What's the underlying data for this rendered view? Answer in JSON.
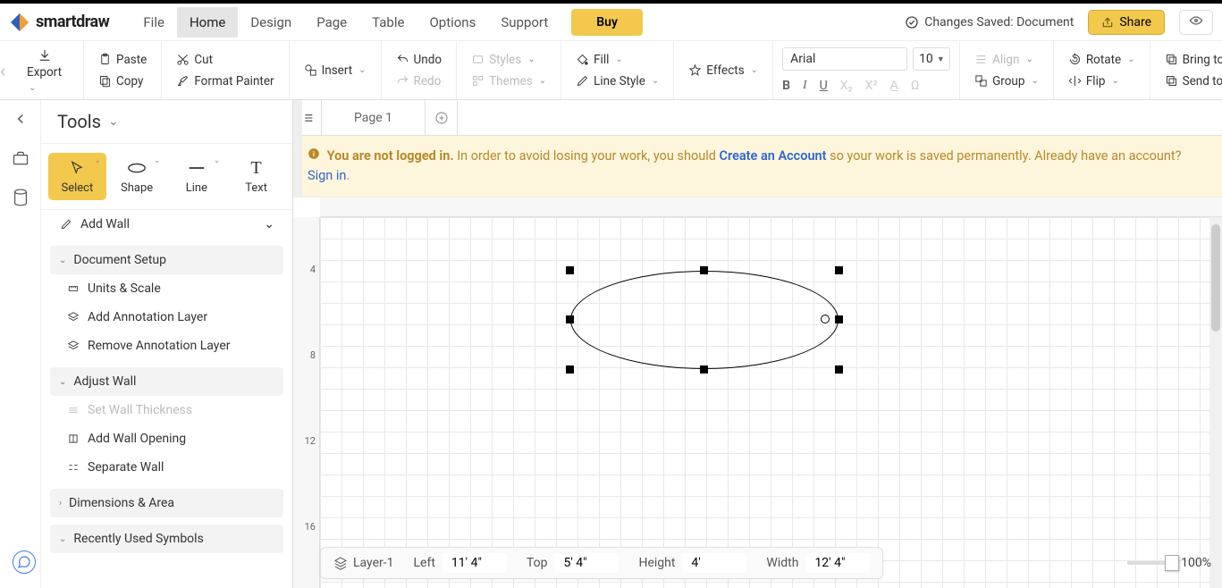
{
  "brand": "smartdraw",
  "menu": {
    "items": [
      "File",
      "Home",
      "Design",
      "Page",
      "Table",
      "Options",
      "Support"
    ],
    "active": "Home"
  },
  "buy_label": "Buy",
  "save_status": "Changes Saved: Document",
  "share_label": "Share",
  "ribbon": {
    "export": "Export",
    "paste": "Paste",
    "cut": "Cut",
    "copy": "Copy",
    "format_painter": "Format Painter",
    "insert": "Insert",
    "undo": "Undo",
    "redo": "Redo",
    "styles": "Styles",
    "themes": "Themes",
    "fill": "Fill",
    "line_style": "Line Style",
    "effects": "Effects",
    "font_name": "Arial",
    "font_size": "10",
    "align": "Align",
    "group": "Group",
    "rotate": "Rotate",
    "flip": "Flip",
    "bring_front": "Bring to Front",
    "send_back": "Send to Back"
  },
  "tools": {
    "title": "Tools",
    "modes": {
      "select": "Select",
      "shape": "Shape",
      "line": "Line",
      "text": "Text"
    },
    "add_wall": "Add Wall",
    "doc_setup": "Document Setup",
    "units_scale": "Units & Scale",
    "add_anno": "Add Annotation Layer",
    "remove_anno": "Remove Annotation Layer",
    "adjust_wall": "Adjust Wall",
    "set_wall_thickness": "Set Wall Thickness",
    "add_wall_opening": "Add Wall Opening",
    "separate_wall": "Separate Wall",
    "dims_area": "Dimensions & Area",
    "recent_symbols": "Recently Used Symbols"
  },
  "page_tab": "Page 1",
  "banner": {
    "bold": "You are not logged in.",
    "mid1": " In order to avoid losing your work, you should ",
    "create": "Create an Account",
    "mid2": " so your work is saved permanently. Already have an account? ",
    "signin": "Sign in",
    "dot": "."
  },
  "ruler_v": [
    "4",
    "8",
    "12",
    "16"
  ],
  "status": {
    "layer": "Layer-1",
    "left_lbl": "Left",
    "left_val": "11' 4\"",
    "top_lbl": "Top",
    "top_val": "5' 4\"",
    "height_lbl": "Height",
    "height_val": "4'",
    "width_lbl": "Width",
    "width_val": "12' 4\""
  },
  "zoom": "100%"
}
